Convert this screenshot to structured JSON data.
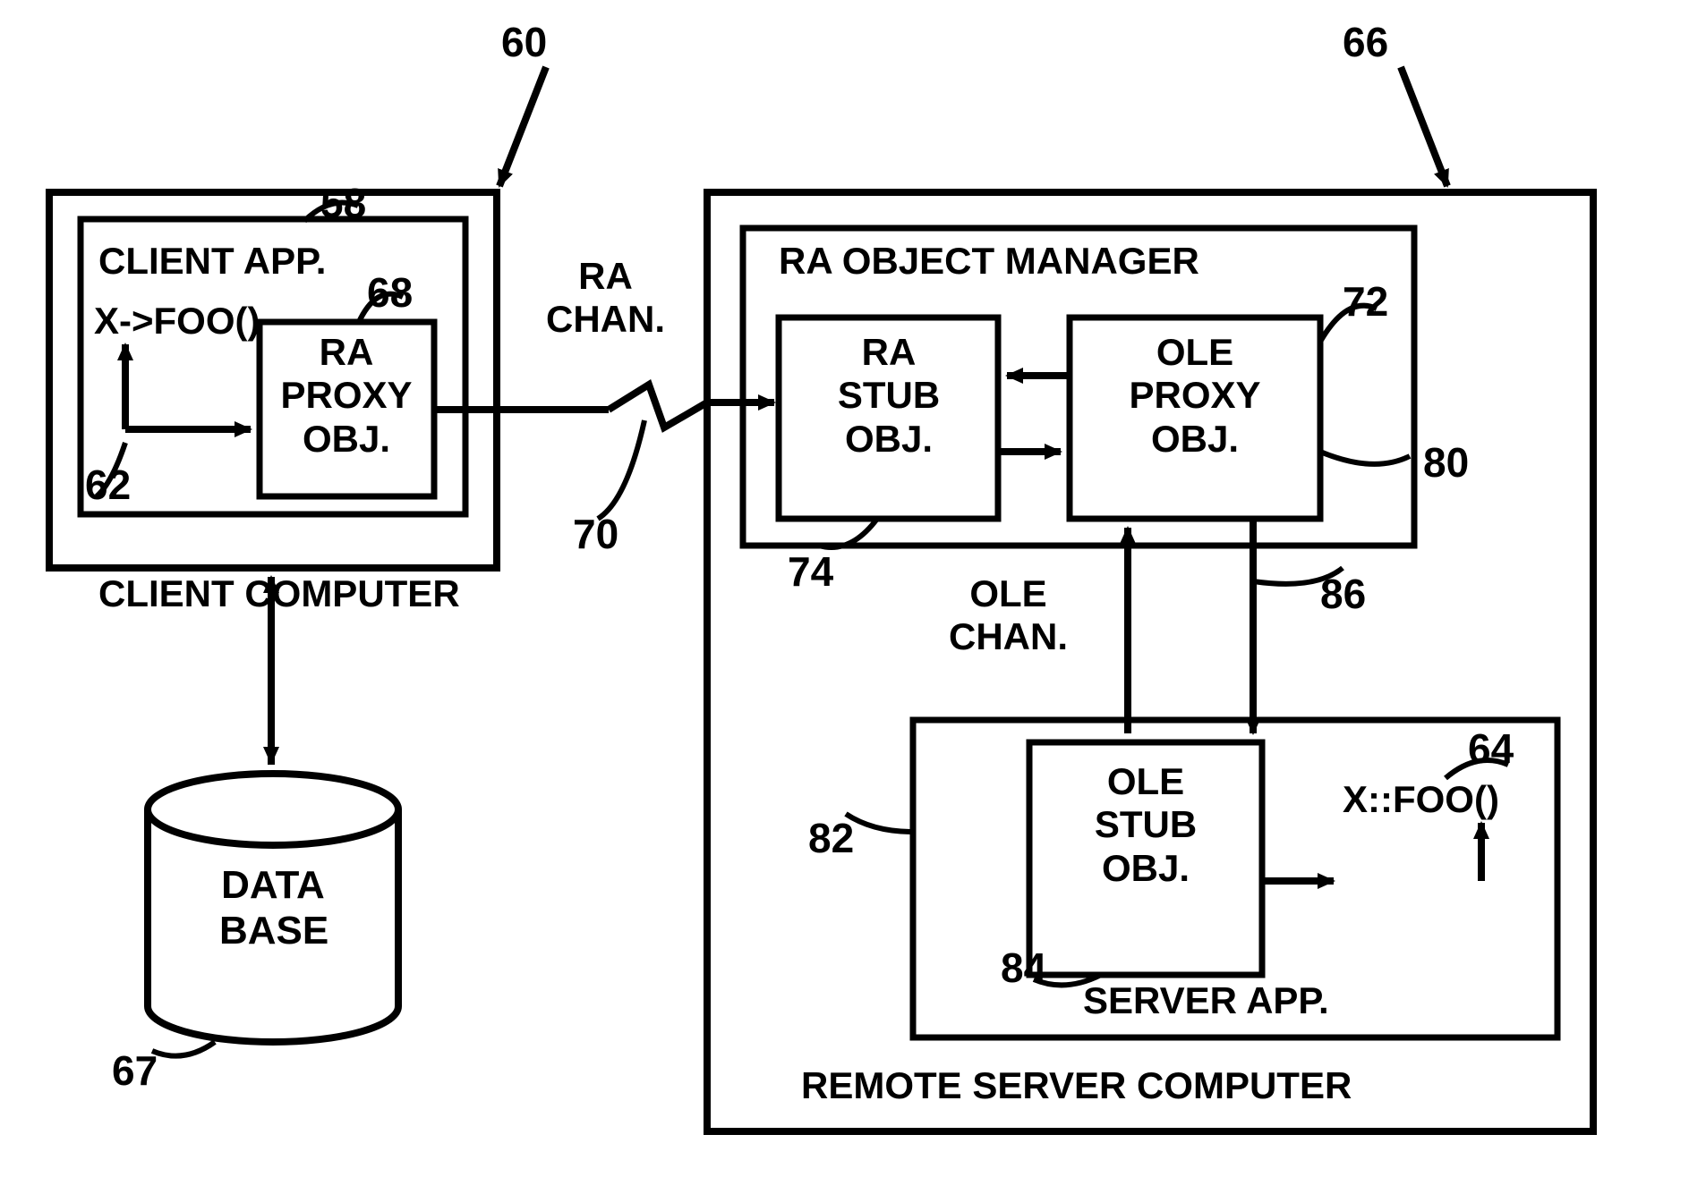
{
  "labels": {
    "client_app": "CLIENT APP.",
    "client_computer": "CLIENT COMPUTER",
    "remote_server": "REMOTE SERVER COMPUTER",
    "ra_obj_manager": "RA OBJECT MANAGER",
    "server_app": "SERVER APP.",
    "x_foo_call": "X->FOO()",
    "ra_proxy": "RA\nPROXY\nOBJ.",
    "ra_chan": "RA\nCHAN.",
    "ra_stub": "RA\nSTUB\nOBJ.",
    "ole_proxy": "OLE\nPROXY\nOBJ.",
    "ole_chan": "OLE\nCHAN.",
    "ole_stub": "OLE\nSTUB\nOBJ.",
    "x_foo_impl": "X::FOO()",
    "database": "DATA\nBASE"
  },
  "refs": {
    "r58": "58",
    "r60": "60",
    "r62": "62",
    "r64": "64",
    "r66": "66",
    "r67": "67",
    "r68": "68",
    "r70": "70",
    "r72": "72",
    "r74": "74",
    "r80": "80",
    "r82": "82",
    "r84": "84",
    "r86": "86"
  }
}
